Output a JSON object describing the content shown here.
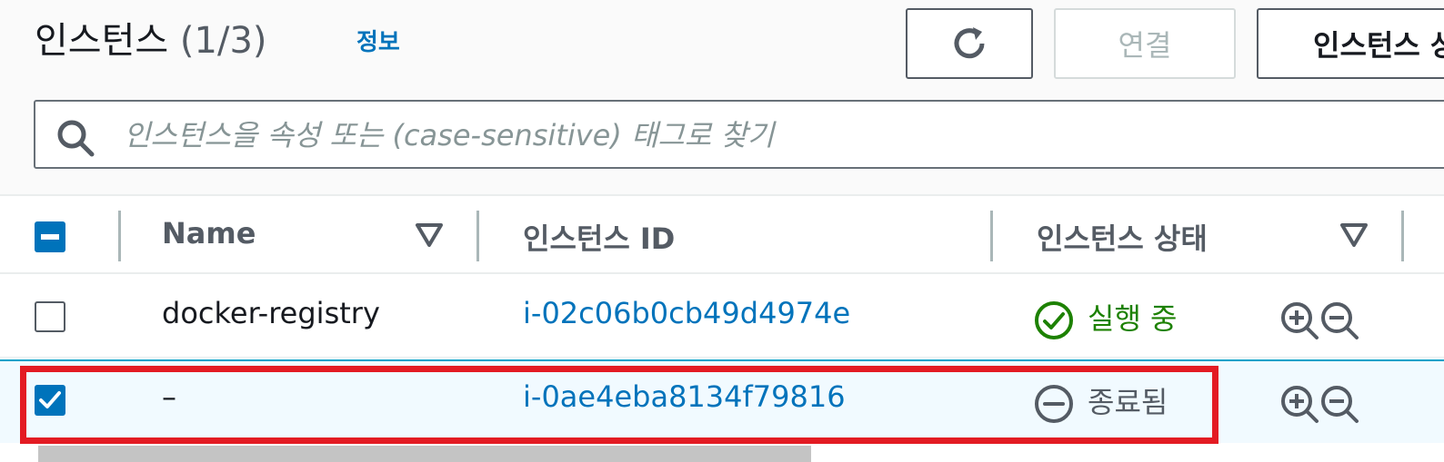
{
  "header": {
    "title": "인스턴스",
    "count": "(1/3)",
    "info_link": "정보",
    "connect_label": "연결",
    "instance_state_label": "인스턴스 상태"
  },
  "search": {
    "placeholder": "인스턴스을 속성 또는 (case-sensitive) 태그로 찾기"
  },
  "table": {
    "columns": {
      "name": "Name",
      "instance_id": "인스턴스 ID",
      "instance_state": "인스턴스 상태"
    },
    "rows": [
      {
        "selected": false,
        "name": "docker-registry",
        "instance_id": "i-02c06b0cb49d4974e",
        "state": "실행 중",
        "state_icon": "check-circle-icon"
      },
      {
        "selected": true,
        "name": "–",
        "instance_id": "i-0ae4eba8134f79816",
        "state": "종료됨",
        "state_icon": "minus-circle-icon"
      }
    ]
  },
  "colors": {
    "link": "#0073bb",
    "running": "#1d8102",
    "terminated": "#545b64",
    "highlight": "#e31b23",
    "selected_row": "#f1faff"
  }
}
